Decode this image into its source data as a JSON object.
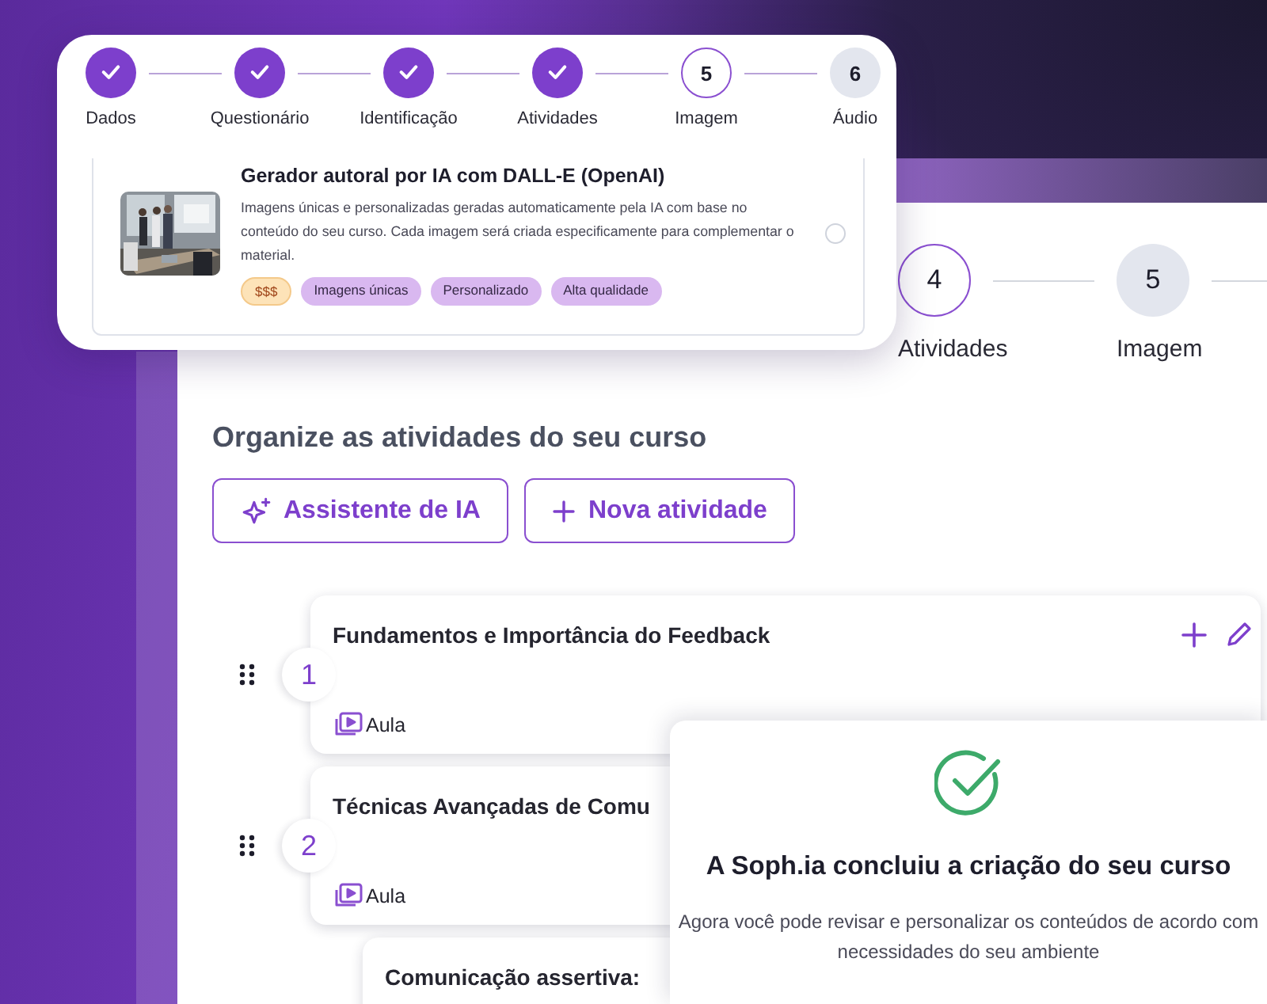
{
  "onboarding_stepper": {
    "steps": [
      {
        "label": "Dados",
        "done": true
      },
      {
        "label": "Questionário",
        "done": true
      },
      {
        "label": "Identificação",
        "done": true
      },
      {
        "label": "Atividades",
        "done": true
      },
      {
        "number": "5",
        "label": "Imagem",
        "done": false,
        "current": true
      },
      {
        "number": "6",
        "label": "Áudio",
        "done": false,
        "current": false
      }
    ]
  },
  "image_option": {
    "title": "Gerador autoral por IA com DALL-E (OpenAI)",
    "description": "Imagens únicas e personalizadas geradas automaticamente pela IA com base no conteúdo do seu curso. Cada imagem será criada especificamente para complementar o material.",
    "selected": false,
    "tags": [
      {
        "text": "$$$",
        "kind": "price"
      },
      {
        "text": "Imagens únicas",
        "kind": "feature"
      },
      {
        "text": "Personalizado",
        "kind": "feature"
      },
      {
        "text": "Alta qualidade",
        "kind": "feature"
      }
    ]
  },
  "main_stepper": {
    "truncated": true,
    "steps": [
      {
        "number": "4",
        "label": "Atividades",
        "done": false,
        "current": true
      },
      {
        "number": "5",
        "label": "Imagem",
        "done": false,
        "current": false
      }
    ]
  },
  "activities": {
    "heading": "Organize as atividades do seu curso",
    "buttons": [
      {
        "label": "Assistente de IA",
        "kind": "ai"
      },
      {
        "label": "Nova atividade",
        "kind": "add"
      }
    ],
    "items": [
      {
        "number": "1",
        "title": "Fundamentos e Importância do Feedback",
        "type": "Aula"
      },
      {
        "number": "2",
        "title": "Técnicas Avançadas de Comu",
        "type": "Aula",
        "children": [
          {
            "title": "Comunicação assertiva:"
          }
        ]
      }
    ]
  },
  "success_panel": {
    "title": "A Soph.ia concluiu a criação do seu curso",
    "text": "Agora você pode revisar e personalizar os conteúdos de acordo com necessidades do seu ambiente"
  }
}
